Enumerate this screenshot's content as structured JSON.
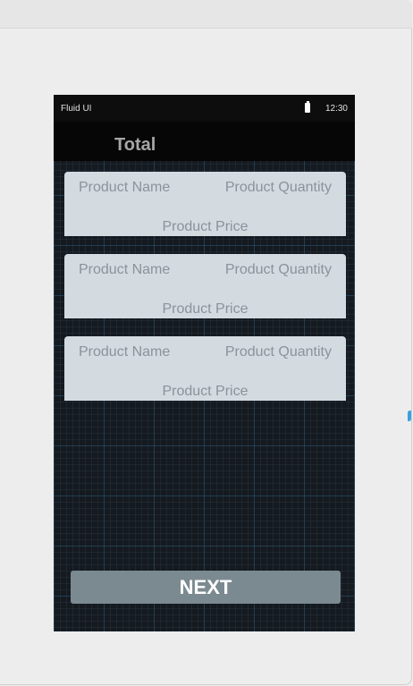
{
  "status_bar": {
    "app_name": "Fluid UI",
    "time": "12:30"
  },
  "header": {
    "title": "Total"
  },
  "products": [
    {
      "name": "Product Name",
      "quantity": "Product Quantity",
      "price": "Product Price"
    },
    {
      "name": "Product Name",
      "quantity": "Product Quantity",
      "price": "Product Price"
    },
    {
      "name": "Product Name",
      "quantity": "Product Quantity",
      "price": "Product Price"
    }
  ],
  "actions": {
    "next_label": "NEXT"
  },
  "colors": {
    "card_background": "#d3dbe0",
    "button_background": "#7b8a90",
    "screen_background": "#141a20"
  }
}
